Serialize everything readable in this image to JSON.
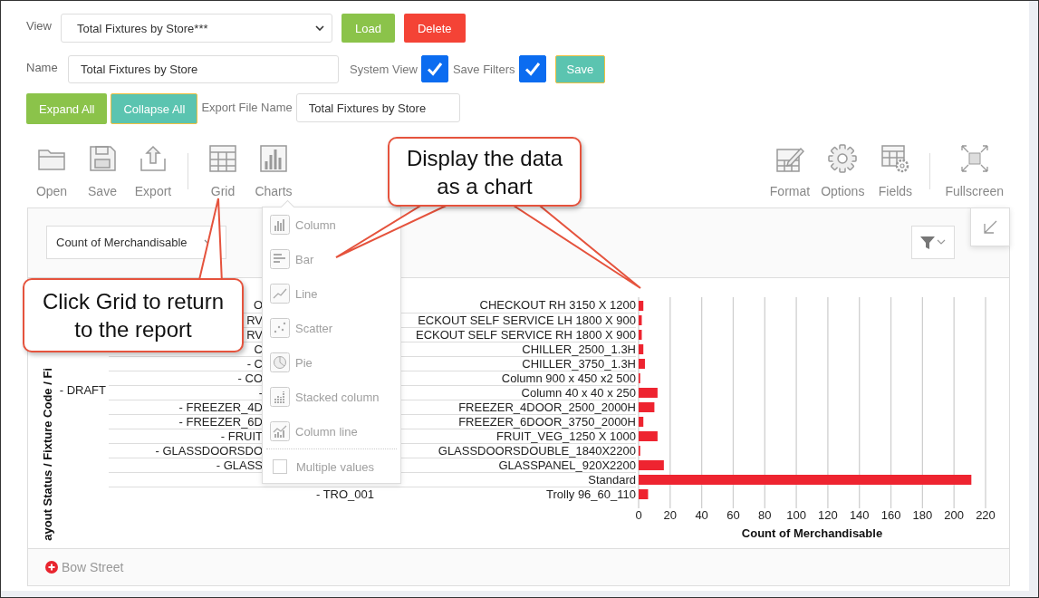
{
  "view": {
    "label": "View",
    "value": "Total Fixtures by Store***"
  },
  "view_buttons": [
    {
      "label": "Load"
    },
    {
      "label": "Delete"
    }
  ],
  "name": {
    "label": "Name",
    "value": "Total Fixtures by Store"
  },
  "options": [
    {
      "label": "System View",
      "checked": true
    },
    {
      "label": "Save Filters",
      "checked": true
    }
  ],
  "save_button": {
    "label": "Save"
  },
  "expand_buttons": [
    {
      "label": "Expand All"
    },
    {
      "label": "Collapse All"
    }
  ],
  "export_name": {
    "label": "Export File Name",
    "value": "Total Fixtures by Store"
  },
  "toolbar": {
    "left": [
      [
        {
          "label": "Open",
          "kind": "open"
        },
        {
          "label": "Save",
          "kind": "save"
        },
        {
          "label": "Export",
          "kind": "export"
        }
      ],
      [
        {
          "label": "Grid",
          "kind": "grid"
        },
        {
          "label": "Charts",
          "kind": "charts"
        }
      ]
    ],
    "right": [
      [
        {
          "label": "Format",
          "kind": "format"
        },
        {
          "label": "Options",
          "kind": "options"
        },
        {
          "label": "Fields",
          "kind": "fields"
        }
      ],
      [
        {
          "label": "Fullscreen",
          "kind": "fullscreen"
        }
      ]
    ]
  },
  "chart_menu": {
    "items": [
      {
        "label": "Column",
        "kind": "column"
      },
      {
        "label": "Bar",
        "kind": "bar"
      },
      {
        "label": "Line",
        "kind": "line"
      },
      {
        "label": "Scatter",
        "kind": "scatter"
      },
      {
        "label": "Pie",
        "kind": "pie"
      },
      {
        "label": "Stacked column",
        "kind": "stacked"
      },
      {
        "label": "Column line",
        "kind": "column-line"
      }
    ],
    "multiple_values": {
      "label": "Multiple values",
      "checked": false
    }
  },
  "pivot": {
    "measure_select": "Count of Merchandisable",
    "footer": "Bow Street",
    "row_axis_title": "ayout Status / Fixture Code / Fi",
    "level_label": "- DRAFT",
    "group_labels": [
      {
        "label": "O"
      },
      {
        "label": "RV"
      },
      {
        "label": "RV"
      },
      {
        "label": "C"
      },
      {
        "label": "- C"
      },
      {
        "label": "- CO"
      },
      {
        "label": "-"
      },
      {
        "label": "- FREEZER_4D"
      },
      {
        "label": "- FREEZER_6D"
      },
      {
        "label": "- FRUIT"
      },
      {
        "label": "- GLASSDOORSDO"
      },
      {
        "label": "- GLASS"
      }
    ],
    "last_group_label": "- TRO_001",
    "chart_data": {
      "type": "bar",
      "orientation": "horizontal",
      "xlabel": "Count of Merchandisable",
      "grid": true,
      "categories": [
        "CHECKOUT RH 3150 X 1200",
        "ECKOUT SELF SERVICE LH 1800 X 900",
        "ECKOUT SELF SERVICE RH 1800 X 900",
        "CHILLER_2500_1.3H",
        "CHILLER_3750_1.3H",
        "Column 900 x 450 x2 500",
        "Column 40 x 40 x 250",
        "FREEZER_4DOOR_2500_2000H",
        "FREEZER_6DOOR_3750_2000H",
        "FRUIT_VEG_1250 X 1000",
        "GLASSDOORSDOUBLE_1840X2200",
        "GLASSPANEL_920X2200",
        "Standard",
        "Trolly 96_60_110"
      ],
      "series": [
        {
          "color": "#ee2430",
          "values": [
            3,
            2,
            2,
            3,
            4,
            1,
            12,
            10,
            3,
            12,
            1,
            16,
            211,
            6
          ]
        }
      ],
      "xlim": [
        0,
        220
      ],
      "xticks": [
        0,
        20,
        40,
        60,
        80,
        100,
        120,
        140,
        160,
        180,
        200,
        220
      ]
    }
  },
  "callouts": [
    {
      "text": "Display the data as a chart"
    },
    {
      "text": "Click Grid to return to the report"
    }
  ]
}
